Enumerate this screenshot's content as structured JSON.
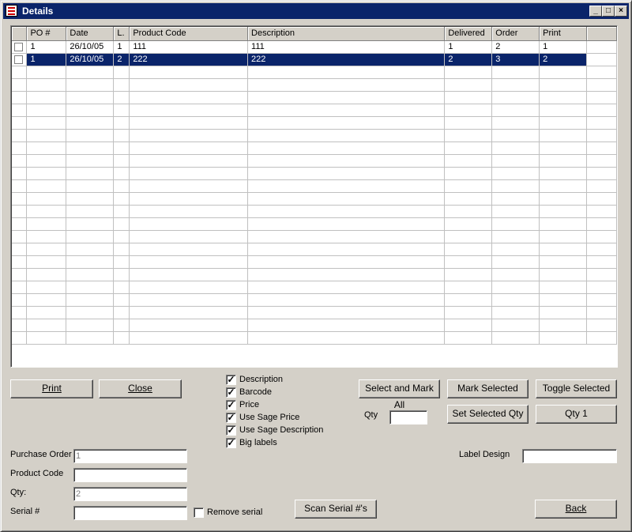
{
  "window": {
    "title": "Details",
    "minimize": "_",
    "maximize": "□",
    "close": "×"
  },
  "grid": {
    "columns": [
      "",
      "PO #",
      "Date",
      "L.",
      "Product Code",
      "Description",
      "Delivered",
      "Order",
      "Print",
      ""
    ],
    "rows": [
      {
        "po": "1",
        "date": "26/10/05",
        "line": "1",
        "product_code": "111",
        "description": "111",
        "delivered": "1",
        "order": "2",
        "print": "1",
        "selected": false
      },
      {
        "po": "1",
        "date": "26/10/05",
        "line": "2",
        "product_code": "222",
        "description": "222",
        "delivered": "2",
        "order": "3",
        "print": "2",
        "selected": true
      }
    ],
    "empty_rows": 22
  },
  "buttons": {
    "print": "Print",
    "close": "Close",
    "select_and_mark_all": "Select and Mark All",
    "mark_selected": "Mark Selected",
    "toggle_selected": "Toggle Selected",
    "set_selected_qty": "Set Selected Qty",
    "qty1": "Qty 1",
    "scan_serial": "Scan Serial #'s",
    "back": "Back"
  },
  "options": [
    {
      "label": "Description",
      "checked": true
    },
    {
      "label": "Barcode",
      "checked": true
    },
    {
      "label": "Price",
      "checked": true
    },
    {
      "label": "Use Sage Price",
      "checked": true
    },
    {
      "label": "Use Sage Description",
      "checked": true
    },
    {
      "label": "Big labels",
      "checked": true
    }
  ],
  "qty": {
    "label": "Qty",
    "value": ""
  },
  "label_design": {
    "label": "Label Design",
    "value": ""
  },
  "form": {
    "purchase_order": {
      "label": "Purchase Order",
      "value": "1"
    },
    "product_code": {
      "label": "Product Code",
      "value": ""
    },
    "qty": {
      "label": "Qty:",
      "value": "2"
    },
    "serial": {
      "label": "Serial #",
      "value": ""
    },
    "remove_serial": {
      "label": "Remove serial",
      "checked": false
    }
  }
}
